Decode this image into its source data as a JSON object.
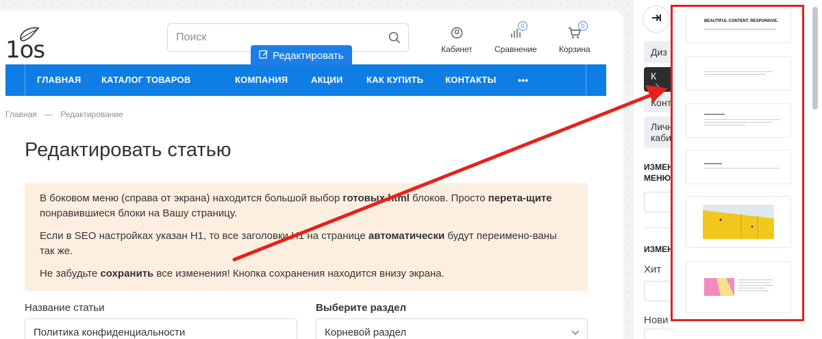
{
  "header": {
    "logo_text": "1os",
    "search_placeholder": "Поиск",
    "icons": [
      {
        "name": "cabinet",
        "label": "Кабинет",
        "badge": ""
      },
      {
        "name": "compare",
        "label": "Сравнение",
        "badge": "0"
      },
      {
        "name": "cart",
        "label": "Корзина",
        "badge": "0"
      }
    ],
    "edit_button": "Редактировать"
  },
  "nav": {
    "items": [
      "ГЛАВНАЯ",
      "КАТАЛОГ ТОВАРОВ",
      "КОМПАНИЯ",
      "АКЦИИ",
      "КАК КУПИТЬ",
      "КОНТАКТЫ"
    ],
    "more": "•••"
  },
  "breadcrumb": {
    "home": "Главная",
    "separator": "—",
    "current": "Редактирование"
  },
  "page_title": "Редактировать статью",
  "notice": {
    "p1": [
      "В боковом меню (справа от экрана) находится большой выбор ",
      "готовых html",
      " блоков. Просто ",
      "перета-щите",
      " понравившиеся блоки на Вашу страницу."
    ],
    "p2": [
      "Если в SEO настройках указан H1, то все заголовки H1 на странице ",
      "автоматически",
      " будут переимено-ваны так же."
    ],
    "p3": [
      "Не забудьте ",
      "сохранить",
      " все изменения! Кнопка сохранения находится внизу экрана."
    ]
  },
  "form": {
    "name_label": "Название статьи",
    "name_value": "Политика конфиденциальности",
    "section_label": "Выберите раздел",
    "section_value": "Корневой раздел"
  },
  "sidebar": {
    "tabs": [
      "Диз",
      "К",
      "Конт",
      "Личн",
      "каби"
    ],
    "heading1": [
      "ИЗМЕН",
      "МЕНЮ"
    ],
    "heading2": "ИЗМЕН",
    "label_hit": "Хит",
    "label_new": "Нови"
  },
  "panel": {
    "thumb1_title": "BEAUTIFUL CONTENT. RESPONSIVE."
  },
  "colors": {
    "accent": "#0e7de4",
    "notice_bg": "#fdefe0",
    "highlight": "#e02020",
    "thumb_yellow": "#f2c81c",
    "thumb_pink": "#f28ac0"
  }
}
